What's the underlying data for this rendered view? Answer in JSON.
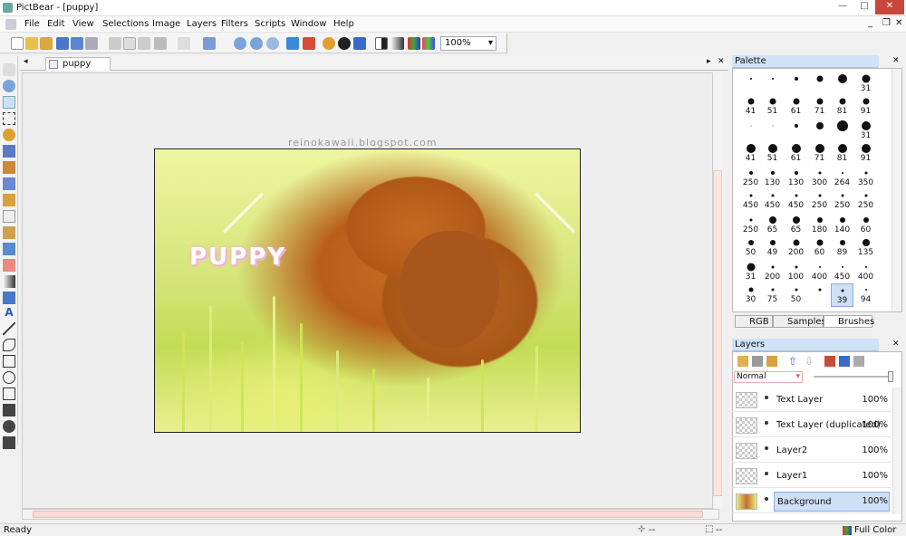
{
  "window": {
    "title": "PictBear - [puppy]"
  },
  "menu": [
    "File",
    "Edit",
    "View",
    "Selections",
    "Image",
    "Layers",
    "Filters",
    "Scripts",
    "Window",
    "Help"
  ],
  "toolbar": {
    "zoom": "100%"
  },
  "document": {
    "tab_label": "puppy",
    "image_text": "PUPPY",
    "watermark": "reinokawaii.blogspot.com"
  },
  "palette": {
    "title": "Palette",
    "brushes": [
      [
        "",
        "",
        "",
        "",
        "",
        "31"
      ],
      [
        "41",
        "51",
        "61",
        "71",
        "81",
        "91"
      ],
      [
        "",
        "",
        "",
        "",
        "",
        "31"
      ],
      [
        "41",
        "51",
        "61",
        "71",
        "81",
        "91"
      ],
      [
        "250",
        "130",
        "130",
        "300",
        "264",
        "350"
      ],
      [
        "450",
        "450",
        "450",
        "250",
        "250",
        "250"
      ],
      [
        "250",
        "65",
        "65",
        "180",
        "140",
        "60"
      ],
      [
        "50",
        "49",
        "200",
        "60",
        "89",
        "135"
      ],
      [
        "31",
        "200",
        "100",
        "400",
        "450",
        "400"
      ],
      [
        "30",
        "75",
        "50",
        "",
        "39",
        "94"
      ]
    ],
    "tabs": [
      "RGB",
      "Samples",
      "Brushes"
    ]
  },
  "layers_panel": {
    "title": "Layers",
    "blend_mode": "Normal",
    "items": [
      {
        "name": "Text Layer",
        "opacity": "100%"
      },
      {
        "name": "Text Layer (duplicated)",
        "opacity": "100%"
      },
      {
        "name": "Layer2",
        "opacity": "100%"
      },
      {
        "name": "Layer1",
        "opacity": "100%"
      },
      {
        "name": "Background",
        "opacity": "100%"
      }
    ]
  },
  "status": {
    "text": "Ready",
    "coord": "--",
    "size": "--",
    "color_mode": "Full Color"
  }
}
